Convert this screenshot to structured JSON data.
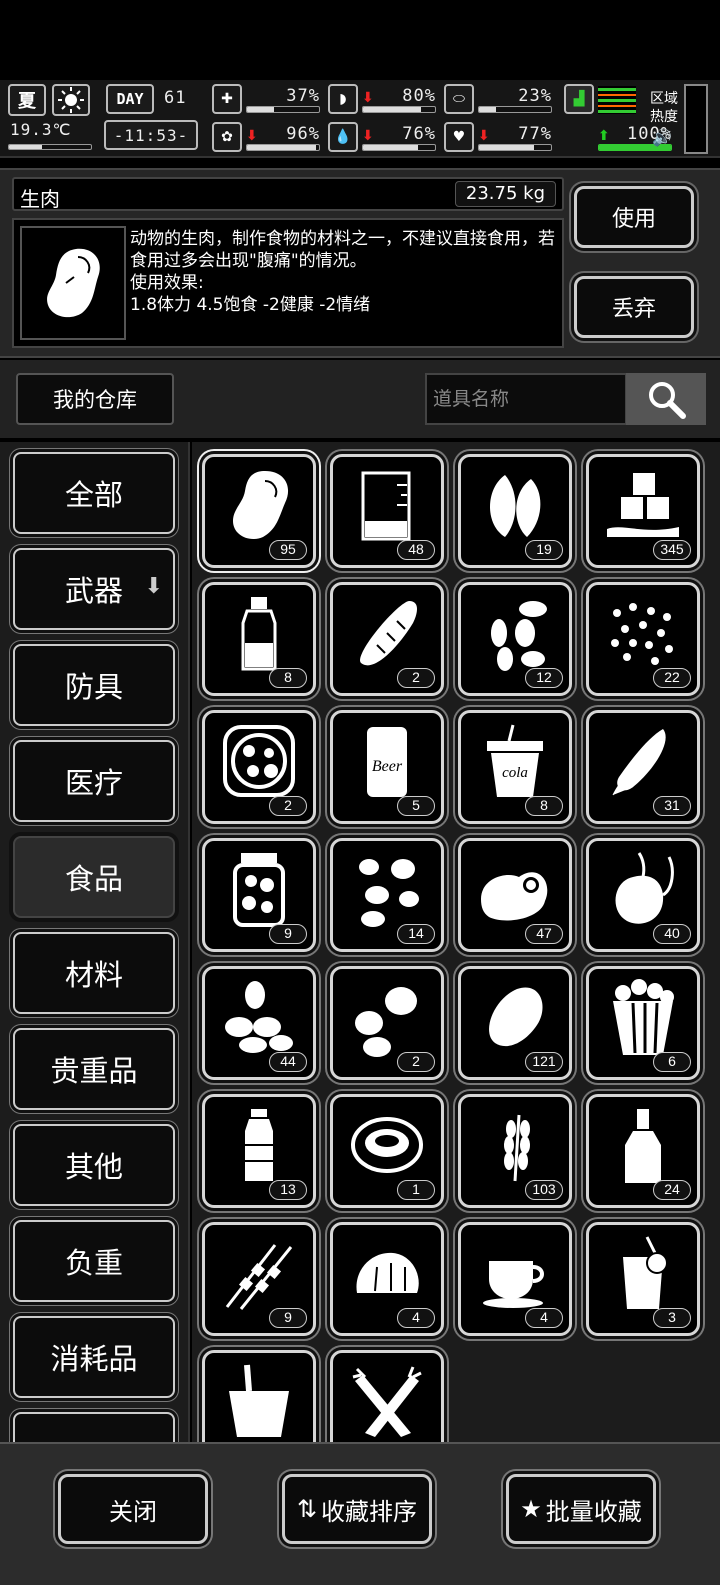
{
  "status": {
    "season": "夏",
    "weather_icon": "sun-icon",
    "day_label": "DAY",
    "day_value": "61",
    "temperature": "19.3℃",
    "time": "-11:53-",
    "stats": [
      {
        "icon": "medkit-icon",
        "value": "37%",
        "fill": 0.37,
        "trend": "none"
      },
      {
        "icon": "stomach-icon",
        "value": "80%",
        "fill": 0.8,
        "trend": "down"
      },
      {
        "icon": "pill-icon",
        "value": "23%",
        "fill": 0.23,
        "trend": "none"
      },
      {
        "icon": "brain-icon",
        "value": "96%",
        "fill": 0.96,
        "trend": "down"
      },
      {
        "icon": "water-drop-icon",
        "value": "76%",
        "fill": 0.76,
        "trend": "down"
      },
      {
        "icon": "heart-icon",
        "value": "77%",
        "fill": 0.77,
        "trend": "down"
      },
      {
        "icon": "boot-icon",
        "value": "100%",
        "fill": 1.0,
        "trend": "up"
      }
    ],
    "zone_heat_label": "区域热度"
  },
  "detail": {
    "item_name": "生肉",
    "weight": "23.75 kg",
    "description": "动物的生肉，制作食物的材料之一，不建议直接食用，若食用过多会出现\"腹痛\"的情况。\n使用效果:\n1.8体力 4.5饱食 -2健康 -2情绪",
    "use_label": "使用",
    "discard_label": "丢弃"
  },
  "storage": {
    "tab_label": "我的仓库",
    "search_placeholder": "道具名称"
  },
  "categories": [
    {
      "label": "全部"
    },
    {
      "label": "武器"
    },
    {
      "label": "防具"
    },
    {
      "label": "医疗"
    },
    {
      "label": "食品"
    },
    {
      "label": "材料"
    },
    {
      "label": "贵重品"
    },
    {
      "label": "其他"
    },
    {
      "label": "负重"
    },
    {
      "label": "消耗品"
    },
    {
      "label": ""
    }
  ],
  "items": [
    {
      "icon": "raw-meat-icon",
      "count": "95"
    },
    {
      "icon": "beaker-icon",
      "count": "48"
    },
    {
      "icon": "leaves-icon",
      "count": "19"
    },
    {
      "icon": "sugar-cubes-icon",
      "count": "345"
    },
    {
      "icon": "bottle-icon",
      "count": "8"
    },
    {
      "icon": "bread-icon",
      "count": "2"
    },
    {
      "icon": "seeds-icon",
      "count": "12"
    },
    {
      "icon": "grains-icon",
      "count": "22"
    },
    {
      "icon": "pizza-icon",
      "count": "2"
    },
    {
      "icon": "beer-can-icon",
      "count": "5"
    },
    {
      "icon": "cola-cup-icon",
      "count": "8"
    },
    {
      "icon": "corn-icon",
      "count": "31"
    },
    {
      "icon": "pickle-jar-icon",
      "count": "9"
    },
    {
      "icon": "cocoons-icon",
      "count": "14"
    },
    {
      "icon": "fried-egg-icon",
      "count": "47"
    },
    {
      "icon": "onion-icon",
      "count": "40"
    },
    {
      "icon": "almonds-icon",
      "count": "44"
    },
    {
      "icon": "potatoes-icon",
      "count": "2"
    },
    {
      "icon": "potato-icon",
      "count": "121"
    },
    {
      "icon": "popcorn-icon",
      "count": "6"
    },
    {
      "icon": "water-bottle-icon",
      "count": "13"
    },
    {
      "icon": "soup-bowl-icon",
      "count": "1"
    },
    {
      "icon": "wheat-icon",
      "count": "103"
    },
    {
      "icon": "liquor-bottle-icon",
      "count": "24"
    },
    {
      "icon": "skewers-icon",
      "count": "9"
    },
    {
      "icon": "bun-icon",
      "count": "4"
    },
    {
      "icon": "coffee-cup-icon",
      "count": "4"
    },
    {
      "icon": "juice-icon",
      "count": "3"
    },
    {
      "icon": "bucket-icon",
      "count": ""
    },
    {
      "icon": "carrots-icon",
      "count": ""
    }
  ],
  "footer": {
    "close_label": "关闭",
    "sort_label": "收藏排序",
    "batch_label": "批量收藏"
  }
}
